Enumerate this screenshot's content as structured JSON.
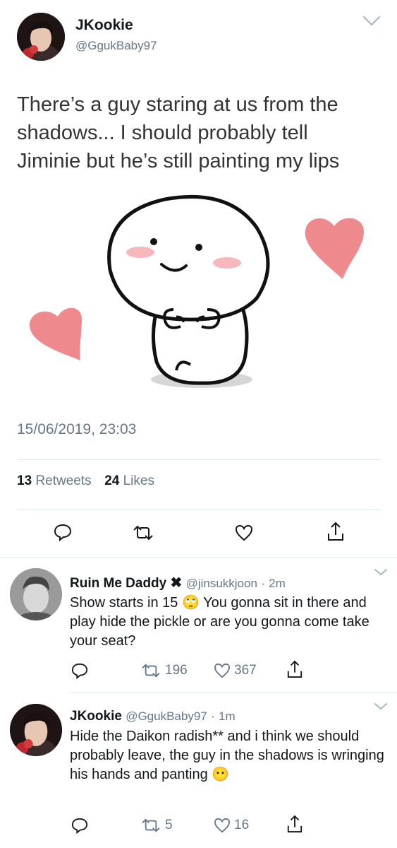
{
  "main_tweet": {
    "display_name": "JKookie",
    "handle": "@GgukBaby97",
    "text": "There’s a guy staring at us from the shadows... I should probably tell Jiminie but he’s still painting my lips",
    "timestamp": "15/06/2019, 23:03",
    "retweet_count": "13",
    "retweet_label": "Retweets",
    "like_count": "24",
    "like_label": "Likes"
  },
  "replies": [
    {
      "display_name": "Ruin Me Daddy",
      "handle": "@jinsukkjoon",
      "sep": "·",
      "time": "2m",
      "text": "Show starts in 15 🙄 You gonna sit in there and play hide the pickle or are you gonna come take your seat?",
      "retweets": "196",
      "likes": "367"
    },
    {
      "display_name": "JKookie",
      "handle": "@GgukBaby97",
      "sep": "·",
      "time": "1m",
      "text": "Hide the Daikon radish** and i think we should probably leave, the guy in the shadows is wringing his hands and panting 😶",
      "retweets": "5",
      "likes": "16"
    }
  ],
  "colors": {
    "heart": "#ee8a8e",
    "muted": "#657786",
    "divider": "#e1e8ed"
  }
}
